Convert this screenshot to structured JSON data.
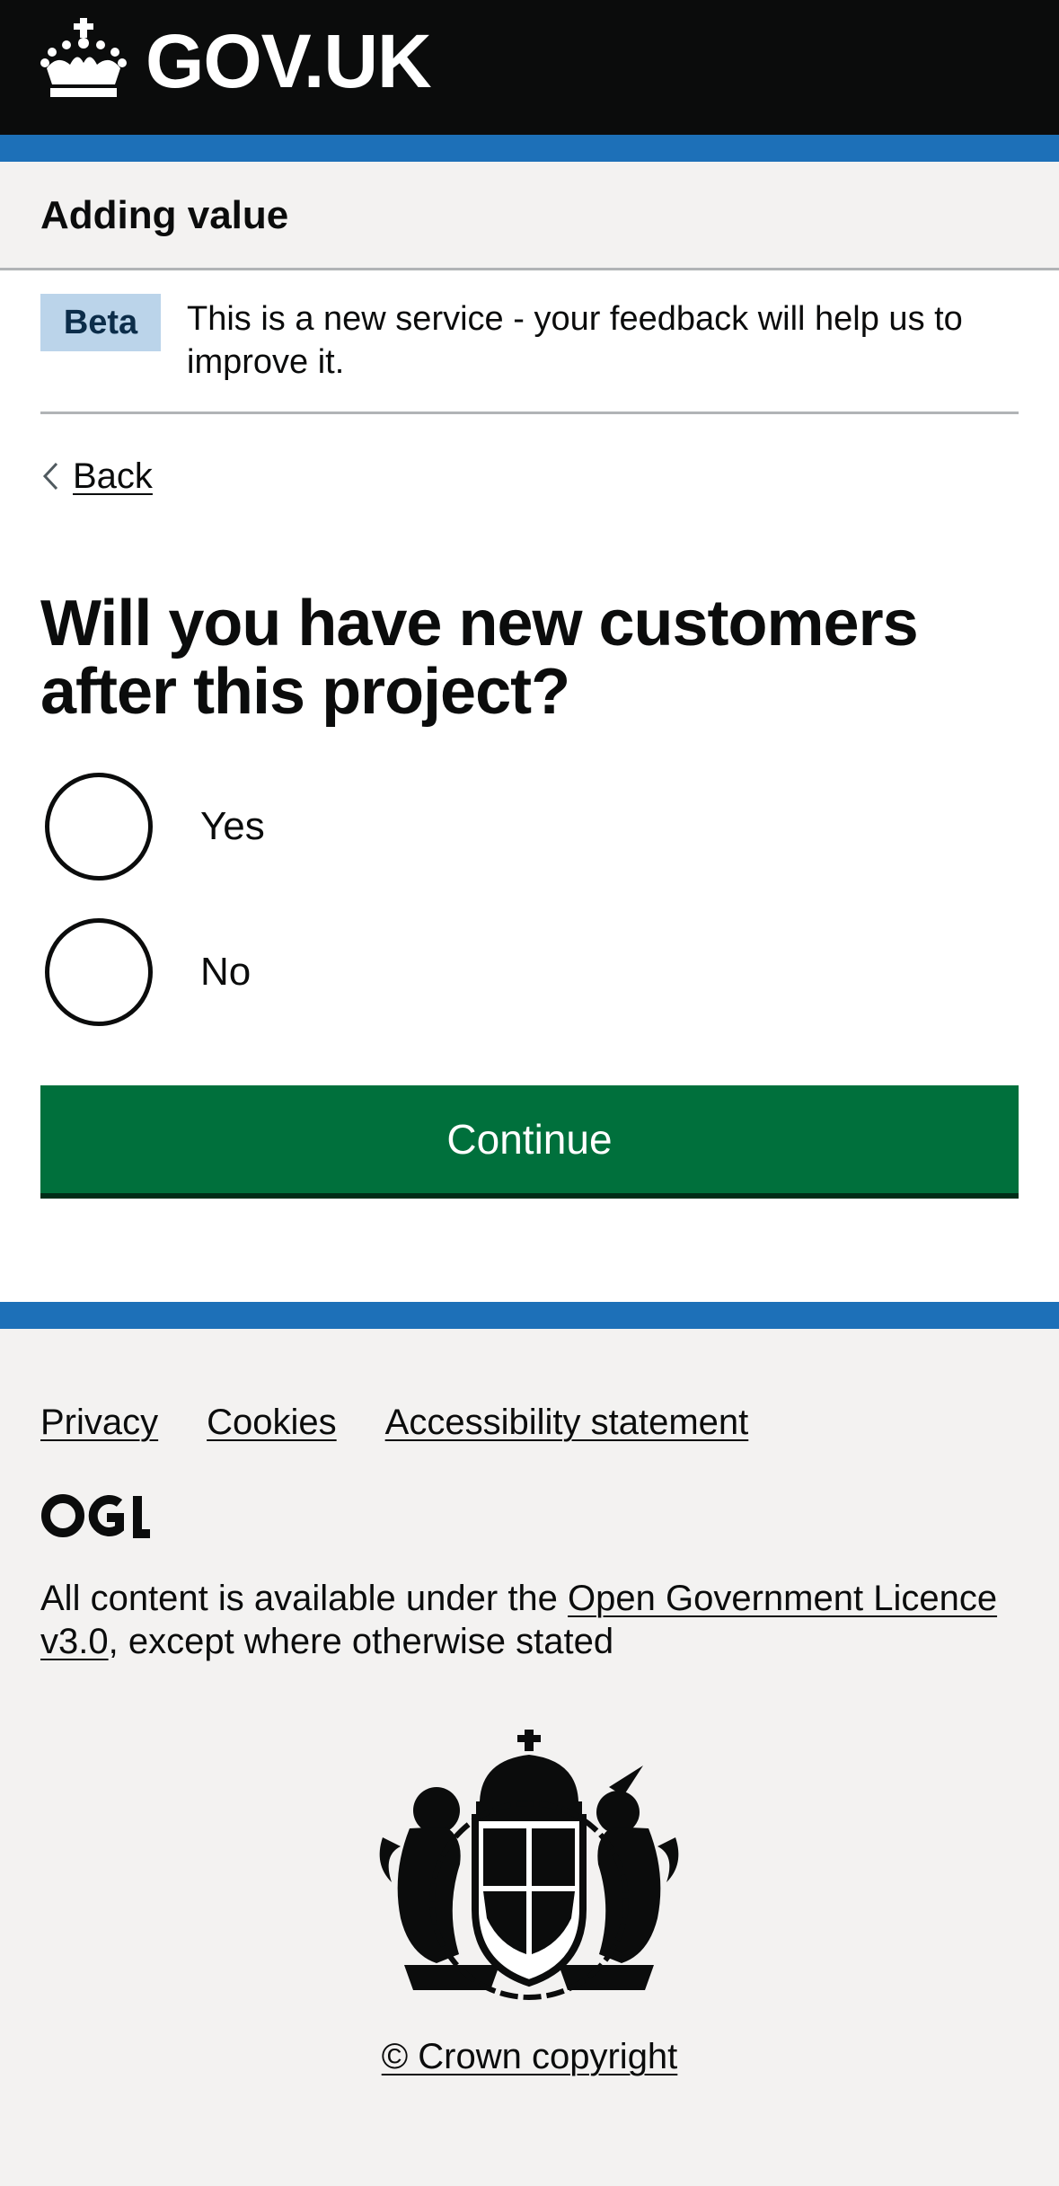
{
  "header": {
    "logo_text": "GOV.UK",
    "logo_icon": "crown-icon"
  },
  "service": {
    "name": "Adding value"
  },
  "phase_banner": {
    "tag": "Beta",
    "text": "This is a new service - your feedback will help us to improve it."
  },
  "back_link": {
    "label": "Back",
    "icon": "chevron-left-icon"
  },
  "question": {
    "heading": "Will you have new customers after this project?",
    "options": [
      {
        "label": "Yes",
        "selected": false
      },
      {
        "label": "No",
        "selected": false
      }
    ]
  },
  "continue_button": {
    "label": "Continue"
  },
  "footer": {
    "links": [
      "Privacy",
      "Cookies",
      "Accessibility statement"
    ],
    "ogl_logo": "OGL",
    "licence_prefix": "All content is available under the ",
    "licence_link": "Open Government Licence v3.0",
    "licence_suffix": ", except where otherwise stated",
    "crest_icon": "royal-coat-of-arms-icon",
    "copyright": "© Crown copyright"
  },
  "colors": {
    "header_bg": "#0b0c0c",
    "brand_blue": "#1d70b8",
    "service_bar_bg": "#f3f2f1",
    "phase_tag_bg": "#bbd4ea",
    "button_green": "#00703c",
    "button_shadow": "#002d18",
    "footer_bg": "#f3f2f1"
  }
}
